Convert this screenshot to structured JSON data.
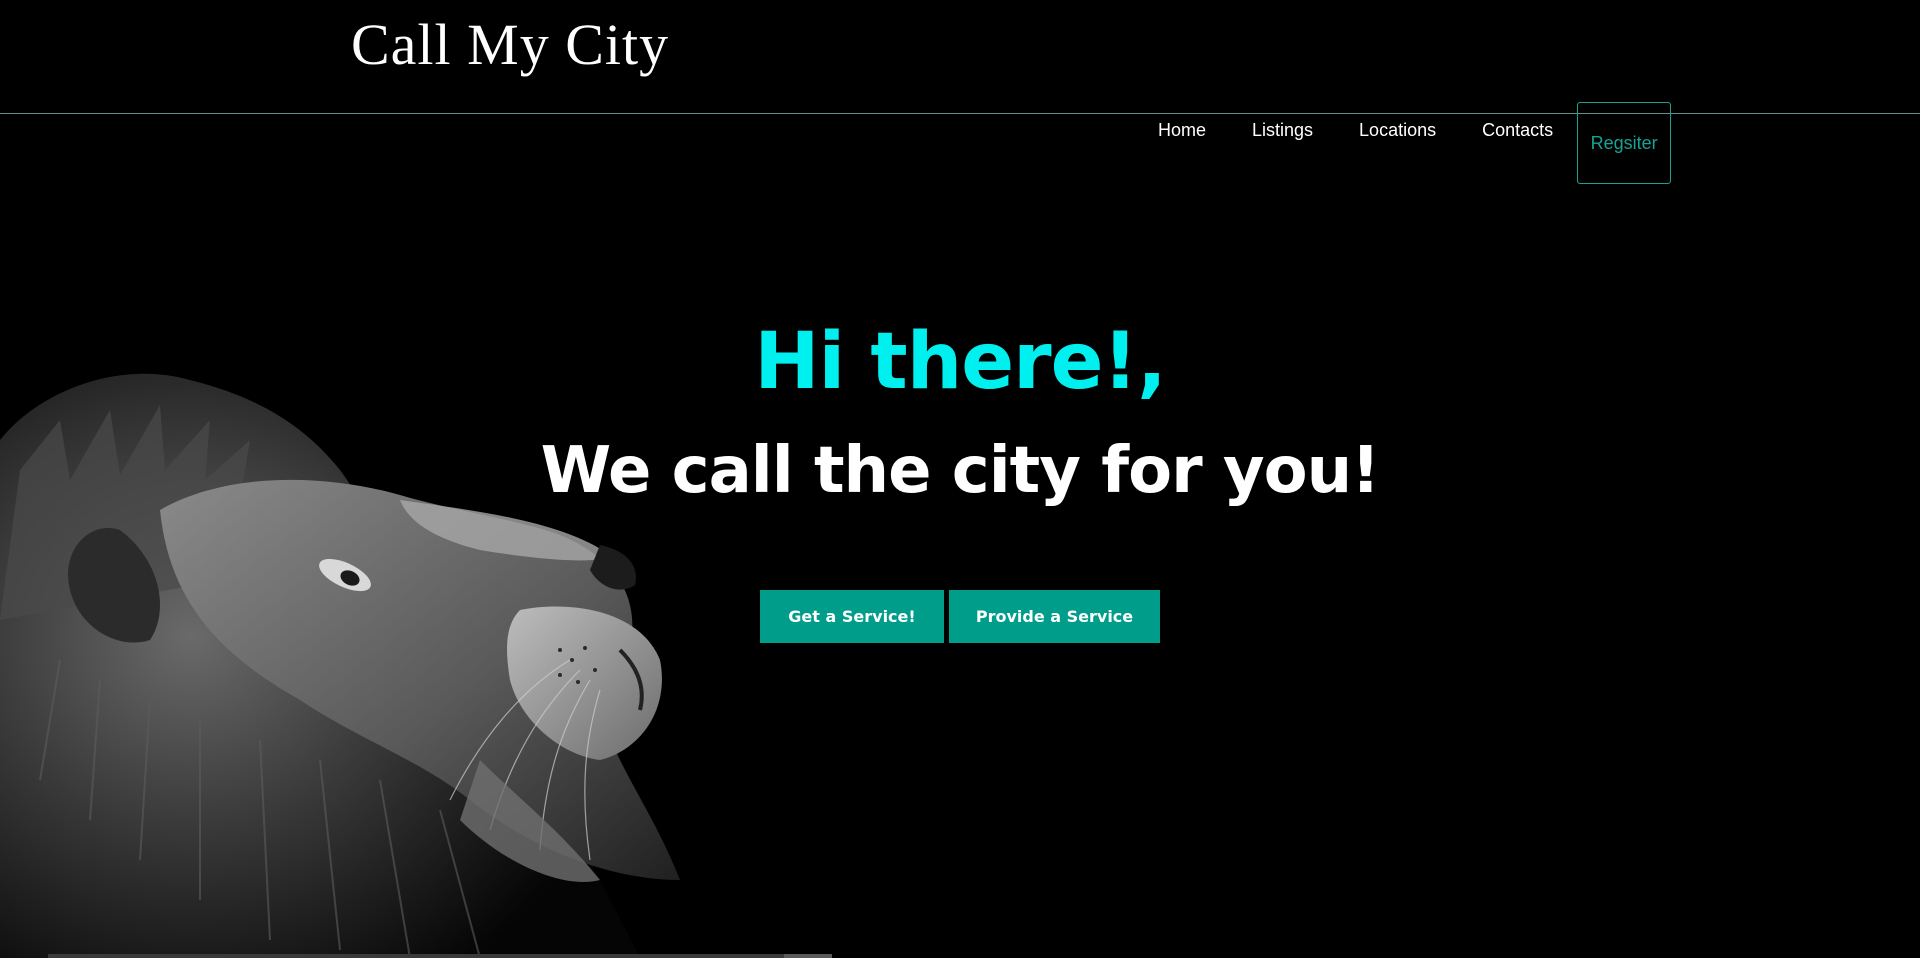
{
  "header": {
    "brand": "Call My City"
  },
  "nav": {
    "items": [
      {
        "label": "Home"
      },
      {
        "label": "Listings"
      },
      {
        "label": "Locations"
      },
      {
        "label": "Contacts"
      }
    ],
    "register_label": "Regsiter"
  },
  "hero": {
    "greeting": "Hi there!,",
    "tagline": "We call the city for you!",
    "buttons": {
      "get_service": "Get a Service!",
      "provide_service": "Provide a Service"
    },
    "image_icon": "lion-profile-image"
  },
  "colors": {
    "background": "#000000",
    "accent": "#16a394",
    "button": "#009d8b",
    "greeting": "#00f0f0",
    "text": "#ffffff"
  }
}
